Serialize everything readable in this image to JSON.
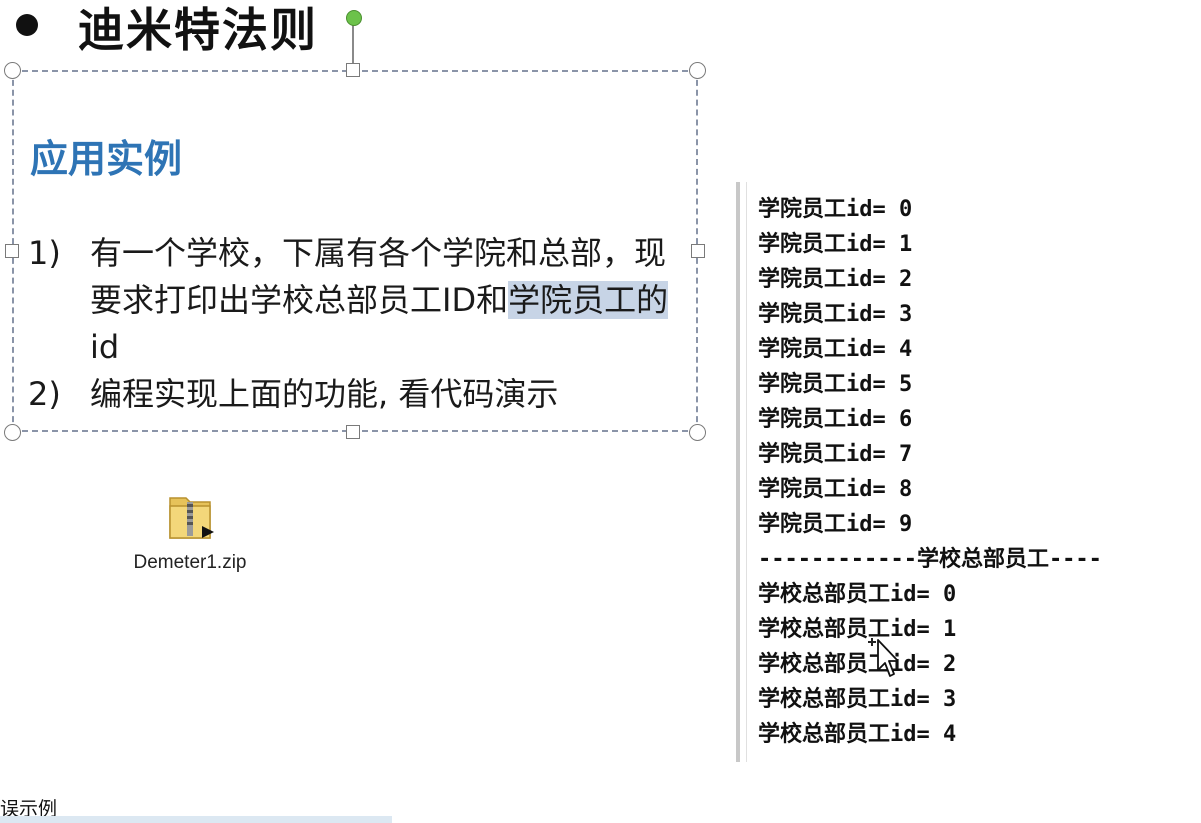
{
  "slide": {
    "title": "迪米特法则",
    "section_heading": "应用实例",
    "items": [
      {
        "number": "1)",
        "text_before": "有一个学校，下属有各个学院和总部，现要求打印出学校总部员工ID和",
        "text_highlighted": "学院员工的",
        "text_after": "id"
      },
      {
        "number": "2)",
        "text": "编程实现上面的功能, 看代码演示"
      }
    ]
  },
  "desktop_file": {
    "icon": "zip-folder-icon",
    "name": "Demeter1.zip"
  },
  "console": {
    "lines": [
      "学院员工id= 0",
      "学院员工id= 1",
      "学院员工id= 2",
      "学院员工id= 3",
      "学院员工id= 4",
      "学院员工id= 5",
      "学院员工id= 6",
      "学院员工id= 7",
      "学院员工id= 8",
      "学院员工id= 9",
      "------------学校总部员工----",
      "学校总部员工id= 0",
      "学校总部员工id= 1",
      "学校总部员工id= 2",
      "学校总部员工id= 3",
      "学校总部员工id= 4"
    ]
  },
  "footer": {
    "text": "误示例"
  },
  "colors": {
    "heading_blue": "#2e74b5",
    "selection_highlight": "#c7d4e6",
    "rotate_handle_green": "#6cc24a"
  }
}
